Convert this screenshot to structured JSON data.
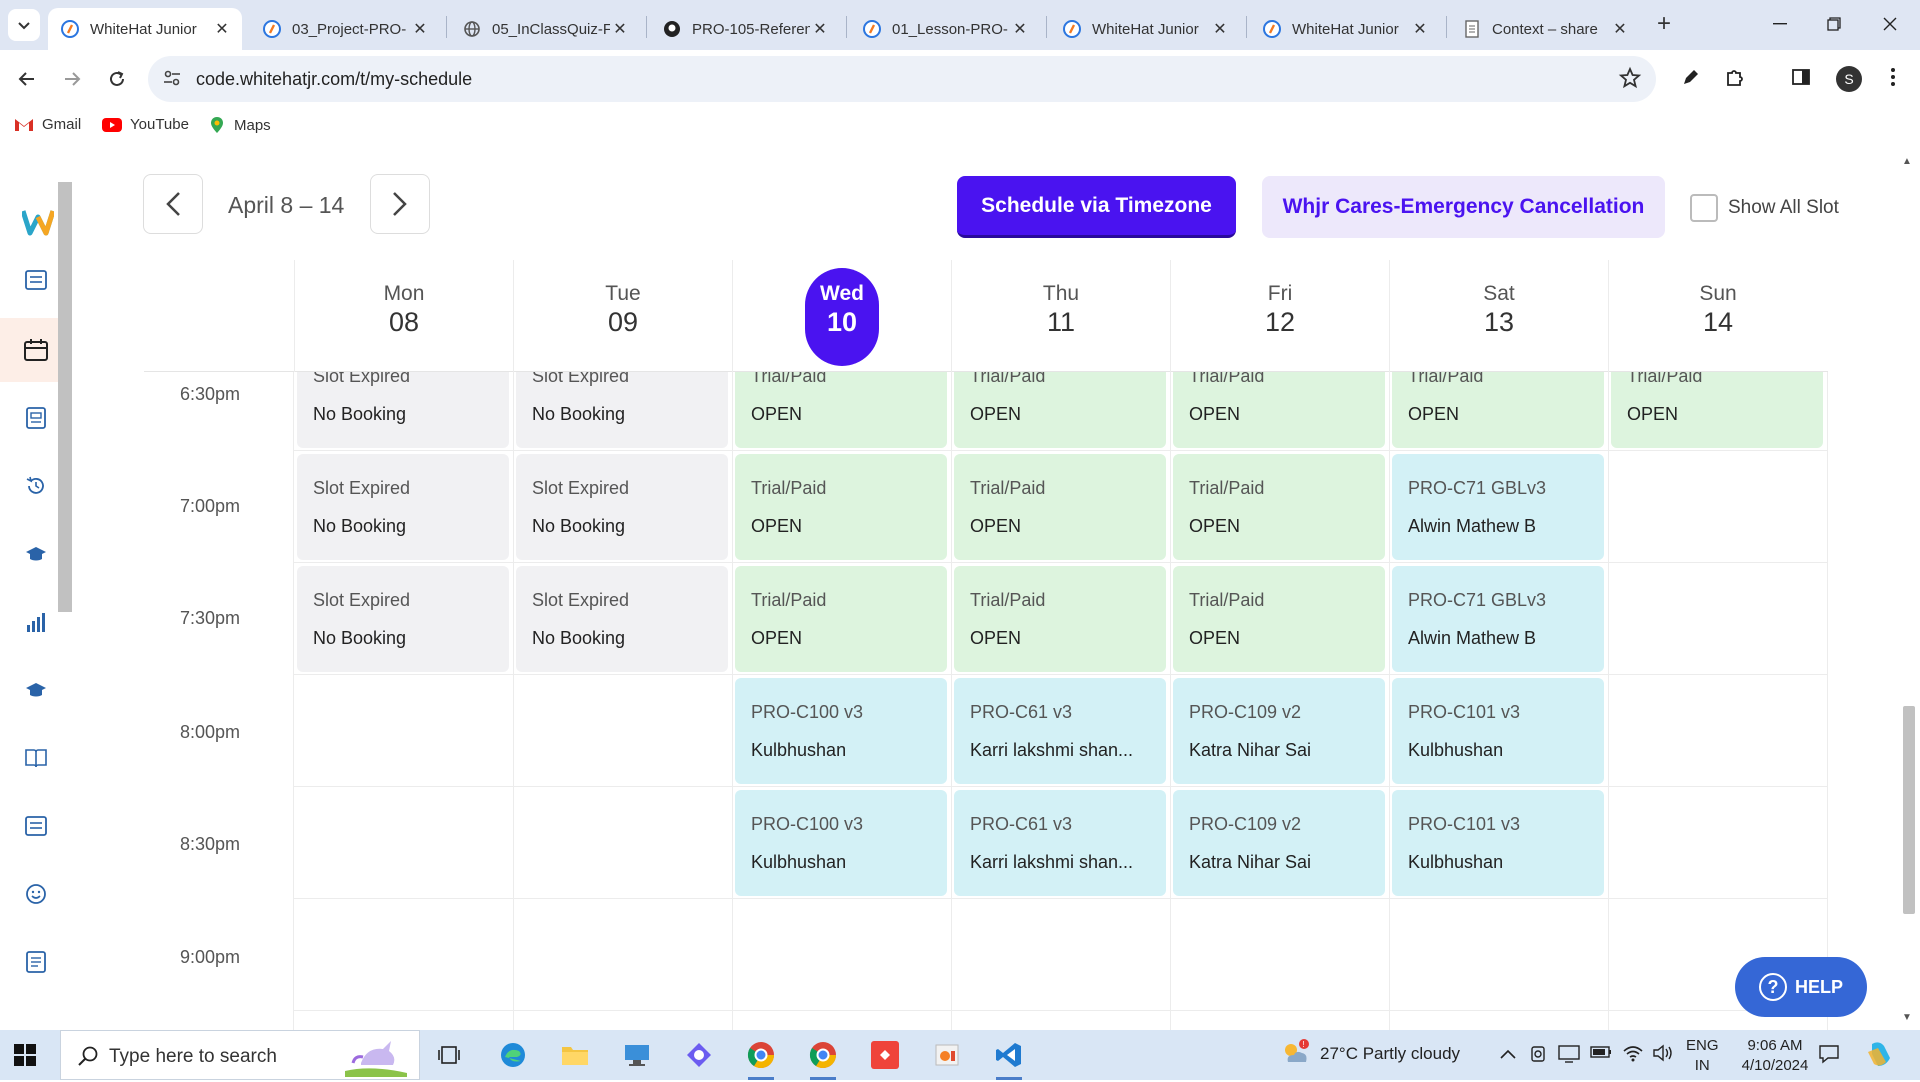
{
  "browser": {
    "tabs": [
      {
        "label": "WhiteHat Junior",
        "active": true
      },
      {
        "label": "03_Project-PRO-"
      },
      {
        "label": "05_InClassQuiz-F"
      },
      {
        "label": "PRO-105-Referen"
      },
      {
        "label": "01_Lesson-PRO-"
      },
      {
        "label": "WhiteHat Junior"
      },
      {
        "label": "WhiteHat Junior"
      },
      {
        "label": "Context – share"
      }
    ],
    "url": "code.whitehatjr.com/t/my-schedule",
    "profile_initial": "S",
    "bookmarks": [
      "Gmail",
      "YouTube",
      "Maps"
    ]
  },
  "schedule": {
    "week_label": "April 8 – 14",
    "schedule_via_timezone": "Schedule via Timezone",
    "cares_cancellation": "Whjr Cares-Emergency Cancellation",
    "show_all_slot": "Show All Slot",
    "days": [
      {
        "name": "Mon",
        "num": "08"
      },
      {
        "name": "Tue",
        "num": "09"
      },
      {
        "name": "Wed",
        "num": "10",
        "today": true
      },
      {
        "name": "Thu",
        "num": "11"
      },
      {
        "name": "Fri",
        "num": "12"
      },
      {
        "name": "Sat",
        "num": "13"
      },
      {
        "name": "Sun",
        "num": "14"
      }
    ],
    "times": [
      "6:30pm",
      "7:00pm",
      "7:30pm",
      "8:00pm",
      "8:30pm",
      "9:00pm"
    ],
    "slots": {
      "r0": [
        {
          "l1": "Slot Expired",
          "l2": "No Booking",
          "kind": "expired"
        },
        {
          "l1": "Slot Expired",
          "l2": "No Booking",
          "kind": "expired"
        },
        {
          "l1": "Trial/Paid",
          "l2": "OPEN",
          "kind": "open"
        },
        {
          "l1": "Trial/Paid",
          "l2": "OPEN",
          "kind": "open"
        },
        {
          "l1": "Trial/Paid",
          "l2": "OPEN",
          "kind": "open"
        },
        {
          "l1": "Trial/Paid",
          "l2": "OPEN",
          "kind": "open"
        },
        {
          "l1": "Trial/Paid",
          "l2": "OPEN",
          "kind": "open"
        }
      ],
      "r1": [
        {
          "l1": "Slot Expired",
          "l2": "No Booking",
          "kind": "expired"
        },
        {
          "l1": "Slot Expired",
          "l2": "No Booking",
          "kind": "expired"
        },
        {
          "l1": "Trial/Paid",
          "l2": "OPEN",
          "kind": "open"
        },
        {
          "l1": "Trial/Paid",
          "l2": "OPEN",
          "kind": "open"
        },
        {
          "l1": "Trial/Paid",
          "l2": "OPEN",
          "kind": "open"
        },
        {
          "l1": "PRO-C71 GBLv3",
          "l2": "Alwin Mathew B",
          "kind": "booked"
        }
      ],
      "r2": [
        {
          "l1": "Slot Expired",
          "l2": "No Booking",
          "kind": "expired"
        },
        {
          "l1": "Slot Expired",
          "l2": "No Booking",
          "kind": "expired"
        },
        {
          "l1": "Trial/Paid",
          "l2": "OPEN",
          "kind": "open"
        },
        {
          "l1": "Trial/Paid",
          "l2": "OPEN",
          "kind": "open"
        },
        {
          "l1": "Trial/Paid",
          "l2": "OPEN",
          "kind": "open"
        },
        {
          "l1": "PRO-C71 GBLv3",
          "l2": "Alwin Mathew B",
          "kind": "booked"
        }
      ],
      "r3": [
        {
          "l1": "PRO-C100 v3",
          "l2": "Kulbhushan",
          "kind": "booked"
        },
        {
          "l1": "PRO-C61 v3",
          "l2": "Karri lakshmi shan...",
          "kind": "booked"
        },
        {
          "l1": "PRO-C109 v2",
          "l2": "Katra Nihar Sai",
          "kind": "booked"
        },
        {
          "l1": "PRO-C101 v3",
          "l2": "Kulbhushan",
          "kind": "booked"
        }
      ],
      "r4": [
        {
          "l1": "PRO-C100 v3",
          "l2": "Kulbhushan",
          "kind": "booked"
        },
        {
          "l1": "PRO-C61 v3",
          "l2": "Karri lakshmi shan...",
          "kind": "booked"
        },
        {
          "l1": "PRO-C109 v2",
          "l2": "Katra Nihar Sai",
          "kind": "booked"
        },
        {
          "l1": "PRO-C101 v3",
          "l2": "Kulbhushan",
          "kind": "booked"
        }
      ]
    },
    "help": "HELP"
  },
  "taskbar": {
    "search_placeholder": "Type here to search",
    "weather": "27°C  Partly cloudy",
    "lang_line1": "ENG",
    "lang_line2": "IN",
    "time": "9:06 AM",
    "date": "4/10/2024"
  },
  "colors": {
    "brand_purple": "#4a13f0",
    "open_green": "#ddf4de",
    "booked_cyan": "#d3f1f6",
    "expired_gray": "#f1f1f3",
    "help_blue": "#3567d6"
  }
}
